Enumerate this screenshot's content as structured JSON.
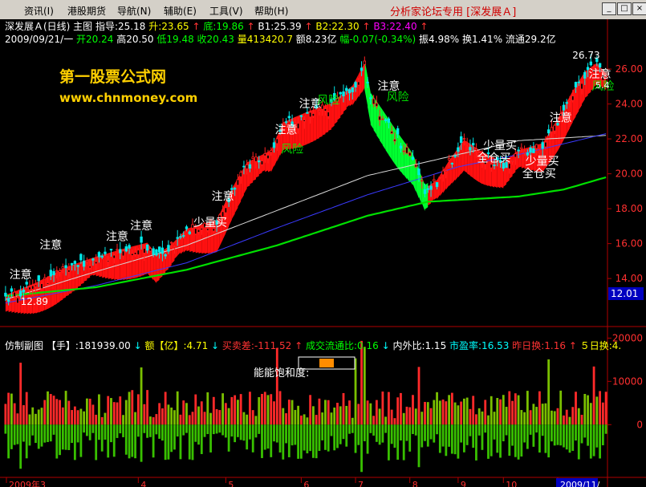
{
  "menu": {
    "items": [
      "资讯(I)",
      "港股期货",
      "导航(N)",
      "辅助(E)",
      "工具(V)",
      "帮助(H)"
    ],
    "app_title": "分析家论坛专用 [深发展Ａ]",
    "buttons": [
      "_",
      "□",
      "×"
    ]
  },
  "main_header": {
    "items": [
      {
        "text": "深发展Ａ(日线) 主图 指导:25.18",
        "color": "#ffffff"
      },
      {
        "text": "升:23.65",
        "color": "#ffff00"
      },
      {
        "text": "↑",
        "color": "#ff3333"
      },
      {
        "text": "底:19.86",
        "color": "#00ff00"
      },
      {
        "text": "↑",
        "color": "#ff3333"
      },
      {
        "text": "B1:25.39",
        "color": "#ffffff"
      },
      {
        "text": "↑",
        "color": "#ff3333"
      },
      {
        "text": "B2:22.30",
        "color": "#ffff00"
      },
      {
        "text": "↑",
        "color": "#ff3333"
      },
      {
        "text": "B3:22.40",
        "color": "#ff00ff"
      },
      {
        "text": "↑",
        "color": "#ff3333"
      }
    ]
  },
  "quote_line": {
    "items": [
      {
        "text": "2009/09/21/一",
        "color": "#ffffff"
      },
      {
        "text": "开20.24",
        "color": "#00ff00"
      },
      {
        "text": "高20.50",
        "color": "#ffffff"
      },
      {
        "text": "低19.48",
        "color": "#00ff00"
      },
      {
        "text": "收20.43",
        "color": "#00ff00"
      },
      {
        "text": "量413420.7",
        "color": "#ffff00"
      },
      {
        "text": "额8.23亿",
        "color": "#ffffff"
      },
      {
        "text": "幅-0.07(-0.34%)",
        "color": "#00ff00"
      },
      {
        "text": "振4.98%",
        "color": "#ffffff"
      },
      {
        "text": "换1.41%",
        "color": "#ffffff"
      },
      {
        "text": "流通29.2亿",
        "color": "#ffffff"
      }
    ]
  },
  "watermark": {
    "title": "第一股票公式网",
    "url": "www.chnmoney.com"
  },
  "sub_header": {
    "items": [
      {
        "text": "仿制副图",
        "color": "#ffffff"
      },
      {
        "text": "【手】:181939.00",
        "color": "#ffffff"
      },
      {
        "text": "↓",
        "color": "#00ffff"
      },
      {
        "text": "额【亿】:4.71",
        "color": "#ffff00"
      },
      {
        "text": "↓",
        "color": "#00ffff"
      },
      {
        "text": "买卖差:-111.52",
        "color": "#ff3333"
      },
      {
        "text": "↑",
        "color": "#ff3333"
      },
      {
        "text": "成交流通比:0.16",
        "color": "#00ff00"
      },
      {
        "text": "↓",
        "color": "#00ffff"
      },
      {
        "text": "内外比:1.15",
        "color": "#ffffff"
      },
      {
        "text": "市盈率:16.53",
        "color": "#00ffff"
      },
      {
        "text": "昨日换:1.16",
        "color": "#ff3333"
      },
      {
        "text": "↑",
        "color": "#ff3333"
      },
      {
        "text": "５日换:4.",
        "color": "#ffff00"
      }
    ]
  },
  "energy_label": "能能饱和度:",
  "price_marks": {
    "high_label": "26.73",
    "low_label": "12.89",
    "right_label": "5.4",
    "current_price_tag": "12.01"
  },
  "chart_data": [
    {
      "type": "candlestick",
      "title": "深发展Ａ(日线)",
      "y_ticks": [
        "26.00",
        "24.00",
        "22.00",
        "20.00",
        "18.00",
        "16.00",
        "14.00"
      ],
      "ylim": [
        11.8,
        27.2
      ],
      "x_ticks": [
        "2009年3",
        "4",
        "5",
        "6",
        "7",
        "8",
        "9",
        "10",
        "2009/11/"
      ],
      "trend": [
        [
          0,
          12.9
        ],
        [
          10,
          13.6
        ],
        [
          20,
          14.5
        ],
        [
          30,
          15.1
        ],
        [
          40,
          15.6
        ],
        [
          47,
          15.9
        ],
        [
          50,
          15.2
        ],
        [
          55,
          15.8
        ],
        [
          60,
          16.7
        ],
        [
          70,
          17.2
        ],
        [
          75,
          19.0
        ],
        [
          80,
          20.5
        ],
        [
          88,
          21.2
        ],
        [
          92,
          22.8
        ],
        [
          100,
          23.4
        ],
        [
          108,
          23.9
        ],
        [
          115,
          24.9
        ],
        [
          119,
          26.2
        ],
        [
          121,
          24.3
        ],
        [
          125,
          23.3
        ],
        [
          130,
          22.0
        ],
        [
          135,
          20.8
        ],
        [
          139,
          19.0
        ],
        [
          143,
          19.5
        ],
        [
          147,
          20.6
        ],
        [
          152,
          21.8
        ],
        [
          158,
          21.1
        ],
        [
          165,
          20.5
        ],
        [
          170,
          21.2
        ],
        [
          178,
          21.6
        ],
        [
          183,
          23.0
        ],
        [
          188,
          24.6
        ],
        [
          192,
          25.7
        ],
        [
          196,
          26.2
        ],
        [
          199,
          25.6
        ]
      ],
      "series": [
        {
          "name": "",
          "color": "#d8d8d8",
          "values": [
            [
              0,
              12.8
            ],
            [
              30,
              14.4
            ],
            [
              60,
              15.9
            ],
            [
              90,
              17.9
            ],
            [
              120,
              19.9
            ],
            [
              150,
              21.1
            ],
            [
              170,
              21.9
            ],
            [
              199,
              22.2
            ]
          ]
        },
        {
          "name": "",
          "color": "#3a3aff",
          "values": [
            [
              0,
              12.6
            ],
            [
              30,
              13.6
            ],
            [
              60,
              14.9
            ],
            [
              90,
              16.9
            ],
            [
              120,
              18.8
            ],
            [
              150,
              20.4
            ],
            [
              170,
              21.1
            ],
            [
              199,
              22.3
            ]
          ]
        },
        {
          "name": "",
          "color": "#00e000",
          "values": [
            [
              0,
              13.0
            ],
            [
              30,
              13.5
            ],
            [
              60,
              14.5
            ],
            [
              90,
              15.9
            ],
            [
              120,
              17.6
            ],
            [
              140,
              18.4
            ],
            [
              170,
              18.7
            ],
            [
              185,
              19.1
            ],
            [
              199,
              19.8
            ]
          ]
        }
      ],
      "annotations": [
        {
          "text": "注意",
          "type": "caution",
          "x": 5,
          "y": 14.0
        },
        {
          "text": "注意",
          "type": "caution",
          "x": 15,
          "y": 15.7
        },
        {
          "text": "注意",
          "type": "caution",
          "x": 37,
          "y": 16.2
        },
        {
          "text": "注意",
          "type": "caution",
          "x": 45,
          "y": 16.8
        },
        {
          "text": "注意",
          "type": "caution",
          "x": 72,
          "y": 18.5
        },
        {
          "text": "注意",
          "type": "caution",
          "x": 93,
          "y": 22.3
        },
        {
          "text": "注意",
          "type": "caution",
          "x": 101,
          "y": 23.8
        },
        {
          "text": "注意",
          "type": "caution",
          "x": 127,
          "y": 24.8
        },
        {
          "text": "注意",
          "type": "caution",
          "x": 184,
          "y": 23.0
        },
        {
          "text": "注意",
          "type": "caution",
          "x": 197,
          "y": 25.5
        },
        {
          "text": "风险",
          "type": "risk",
          "x": 95,
          "y": 21.2
        },
        {
          "text": "风险",
          "type": "risk",
          "x": 107,
          "y": 24.0
        },
        {
          "text": "风险",
          "type": "risk",
          "x": 130,
          "y": 24.2
        },
        {
          "text": "风险",
          "type": "risk",
          "x": 198,
          "y": 24.8
        },
        {
          "text": "少量买",
          "type": "buy",
          "x": 66,
          "y": 17.0
        },
        {
          "text": "少量买",
          "type": "buy",
          "x": 162,
          "y": 21.4
        },
        {
          "text": "少量买",
          "type": "buy",
          "x": 176,
          "y": 20.5
        },
        {
          "text": "全仓买",
          "type": "fullbuy",
          "x": 160,
          "y": 20.7
        },
        {
          "text": "全仓买",
          "type": "fullbuy",
          "x": 175,
          "y": 19.8
        }
      ]
    },
    {
      "type": "bar",
      "title": "仿制副图",
      "y_ticks": [
        "20000",
        "10000",
        "0"
      ],
      "ylim": [
        -12000,
        21000
      ]
    }
  ]
}
